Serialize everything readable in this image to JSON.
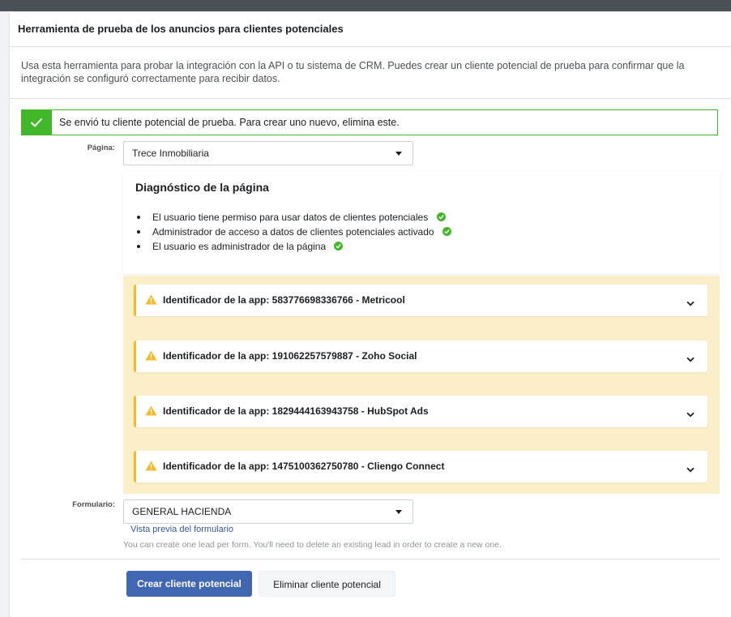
{
  "panel": {
    "title": "Herramienta de prueba de los anuncios para clientes potenciales",
    "description": "Usa esta herramienta para probar la integración con la API o tu sistema de CRM. Puedes crear un cliente potencial de prueba para confirmar que la integración se configuró correctamente para recibir datos."
  },
  "success_banner": {
    "message": "Se envió tu cliente potencial de prueba. Para crear uno nuevo, elimina este.",
    "color": "#42b72a"
  },
  "page_field": {
    "label": "Página:",
    "value": "Trece Inmobiliaria"
  },
  "diagnostics": {
    "title": "Diagnóstico de la página",
    "items": [
      {
        "text": "El usuario tiene permiso para usar datos de clientes potenciales",
        "status": "check-circle-icon"
      },
      {
        "text": "Administrador de acceso a datos de clientes potenciales activado",
        "status": "check-circle-icon"
      },
      {
        "text": "El usuario es administrador de la página",
        "status": "check-circle-icon"
      }
    ]
  },
  "apps": [
    {
      "label": "Identificador de la app: 583776698336766 - Metricool",
      "icon": "warning-icon"
    },
    {
      "label": "Identificador de la app: 191062257579887 - Zoho Social",
      "icon": "warning-icon"
    },
    {
      "label": "Identificador de la app: 1829444163943758 - HubSpot Ads",
      "icon": "warning-icon"
    },
    {
      "label": "Identificador de la app: 1475100362750780 - Cliengo Connect",
      "icon": "warning-icon"
    }
  ],
  "form_field": {
    "label": "Formulario:",
    "value": "GENERAL HACIENDA",
    "preview_link": "Vista previa del formulario",
    "hint": "You can create one lead per form. You'll need to delete an existing lead in order to create a new one."
  },
  "actions": {
    "create_label": "Crear cliente potencial",
    "delete_label": "Eliminar cliente potencial",
    "primary_color": "#4267b2"
  }
}
